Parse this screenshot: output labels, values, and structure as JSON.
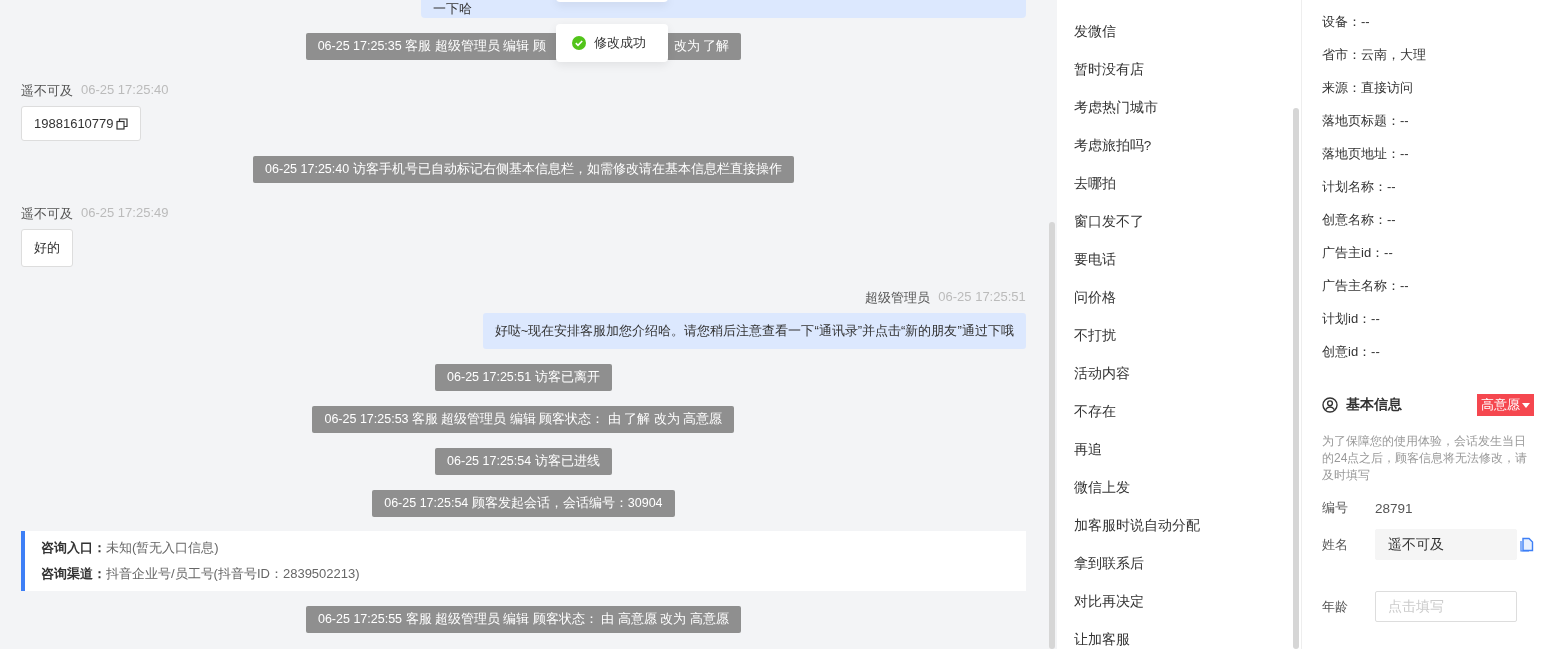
{
  "chat": {
    "messages": [
      {
        "kind": "agent-cut",
        "text": "一下哈"
      },
      {
        "kind": "system-covered",
        "parts": [
          "06-25 17:25:35 客服 超级管理员 编辑 顾",
          "改为 了解"
        ]
      },
      {
        "kind": "visitor",
        "name": "遥不可及",
        "time": "06-25 17:25:40",
        "text": "19881610779",
        "copyable": true
      },
      {
        "kind": "system",
        "text": "06-25 17:25:40 访客手机号已自动标记右侧基本信息栏，如需修改请在基本信息栏直接操作"
      },
      {
        "kind": "visitor",
        "name": "遥不可及",
        "time": "06-25 17:25:49",
        "text": "好的",
        "copyable": false
      },
      {
        "kind": "agent",
        "name": "超级管理员",
        "time": "06-25 17:25:51",
        "text": "好哒~现在安排客服加您介绍哈。请您稍后注意查看一下“通讯录”并点击“新的朋友”通过下哦"
      },
      {
        "kind": "system",
        "text": "06-25 17:25:51 访客已离开"
      },
      {
        "kind": "system",
        "text": "06-25 17:25:53 客服 超级管理员 编辑 顾客状态： 由 了解 改为 高意愿"
      },
      {
        "kind": "system",
        "text": "06-25 17:25:54 访客已进线"
      },
      {
        "kind": "system",
        "text": "06-25 17:25:54 顾客发起会话，会话编号：30904"
      },
      {
        "kind": "entry-card",
        "rows": [
          {
            "label": "咨询入口：",
            "value": "未知(暂无入口信息)"
          },
          {
            "label": "咨询渠道：",
            "value": "抖音企业号/员工号(抖音号ID：2839502213)"
          }
        ]
      },
      {
        "kind": "system",
        "text": "06-25 17:25:55 客服 超级管理员 编辑 顾客状态： 由 高意愿 改为 高意愿"
      }
    ]
  },
  "toast": {
    "text": "修改成功"
  },
  "quick_replies": [
    "发微信",
    "暂时没有店",
    "考虑热门城市",
    "考虑旅拍吗?",
    "去哪拍",
    "窗口发不了",
    "要电话",
    "问价格",
    "不打扰",
    "活动内容",
    "不存在",
    "再追",
    "微信上发",
    "加客服时说自动分配",
    "拿到联系后",
    "对比再决定",
    "让加客服"
  ],
  "visitor_info": [
    "设备：--",
    "省市：云南，大理",
    "来源：直接访问",
    "落地页标题：--",
    "落地页地址：--",
    "计划名称：--",
    "创意名称：--",
    "广告主id：--",
    "广告主名称：--",
    "计划id：--",
    "创意id：--"
  ],
  "basic_info": {
    "title": "基本信息",
    "status": "高意愿",
    "note": "为了保障您的使用体验，会话发生当日的24点之后，顾客信息将无法修改，请及时填写",
    "fields": [
      {
        "kind": "text",
        "label": "编号",
        "value": "28791"
      },
      {
        "kind": "filled",
        "label": "姓名",
        "value": "遥不可及"
      },
      {
        "kind": "empty",
        "label": "年龄",
        "placeholder": "点击填写"
      }
    ]
  }
}
